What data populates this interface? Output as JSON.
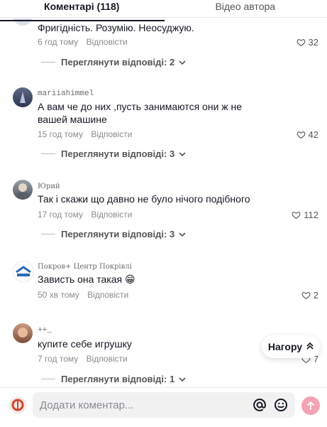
{
  "tabs": [
    {
      "label": "Коментарі (118)",
      "active": true
    },
    {
      "label": "Відео автора",
      "active": false
    }
  ],
  "comments": [
    {
      "username": "",
      "text": "Фригідність. Розумію. Неосуджую.",
      "time": "6 год тому",
      "reply_label": "Відповісти",
      "likes": "32",
      "view_replies": "Переглянути відповіді: 2"
    },
    {
      "username": "mariiahimmel",
      "text": "А вам че до них ,пусть занимаются они ж не вашей машине",
      "time": "15 год тому",
      "reply_label": "Відповісти",
      "likes": "42",
      "view_replies": "Переглянути відповіді: 3"
    },
    {
      "username": "Юрий",
      "text": "Так і скажи що давно не було нічого подібного",
      "time": "17 год тому",
      "reply_label": "Відповісти",
      "likes": "112",
      "view_replies": "Переглянути відповіді: 3"
    },
    {
      "username": "Покров+ Центр Покрівлі",
      "text": "Зависть она такая 😁",
      "time": "50 хв тому",
      "reply_label": "Відповісти",
      "likes": "2"
    },
    {
      "username": "++_",
      "text": "купите себе игрушку",
      "time": "7 год тому",
      "reply_label": "Відповісти",
      "likes": "7",
      "view_replies": "Переглянути відповіді: 1"
    }
  ],
  "back_to_top": "Нагору",
  "comment_input": {
    "placeholder": "Додати коментар..."
  },
  "colors": {
    "send_button": "#f5a3b2",
    "text": "#161823",
    "muted": "#8a8b91"
  },
  "icons": [
    "heart-icon",
    "chevron-down-icon",
    "at-icon",
    "emoji-icon",
    "arrow-up-icon",
    "double-chevron-up-icon"
  ]
}
